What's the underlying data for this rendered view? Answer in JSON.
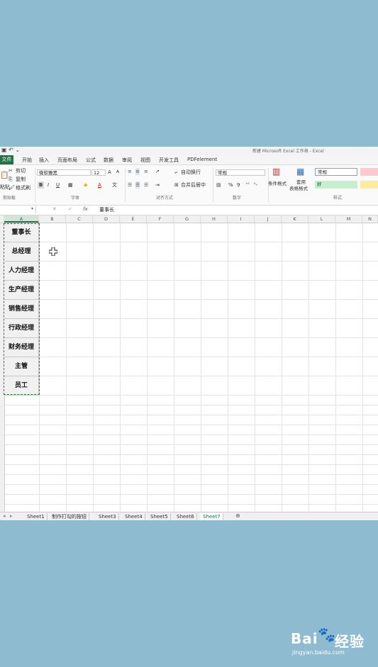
{
  "window": {
    "title": "新建 Microsoft Excel 工作表 - Excel",
    "qa_icons": "▣ ↶ ⌄"
  },
  "menu": {
    "file": "文件",
    "tabs": [
      "开始",
      "插入",
      "页面布局",
      "公式",
      "数据",
      "审阅",
      "视图",
      "开发工具",
      "PDFelement"
    ]
  },
  "ribbon": {
    "clipboard": {
      "cut": "剪切",
      "copy": "复制",
      "format_painter": "格式刷",
      "paste": "粘贴",
      "group": "剪贴板"
    },
    "font": {
      "name": "微软雅黑",
      "size": "12",
      "bold": "B",
      "italic": "I",
      "underline": "U",
      "grow": "A",
      "shrink": "A",
      "wen": "文",
      "group": "字体"
    },
    "alignment": {
      "wrap": "自动换行",
      "merge": "合并后居中",
      "group": "对齐方式"
    },
    "number": {
      "format": "常规",
      "percent": "%",
      "comma": "9",
      "group": "数字"
    },
    "styles": {
      "conditional": "条件格式",
      "table_format_1": "套用",
      "table_format_2": "表格格式",
      "normal": "常规",
      "good": "好",
      "group": "样式"
    }
  },
  "formula_bar": {
    "fx": "fx",
    "content": "董事长"
  },
  "columns": [
    "A",
    "B",
    "C",
    "D",
    "E",
    "F",
    "G",
    "H",
    "I",
    "J",
    "K",
    "L",
    "M",
    "N"
  ],
  "cells_a": [
    "董事长",
    "总经理",
    "人力经理",
    "生产经理",
    "销售经理",
    "行政经理",
    "财务经理",
    "主管",
    "员工"
  ],
  "sheets": [
    "Sheet1",
    "制作打勾的按钮",
    "Sheet3",
    "Sheet4",
    "Sheet5",
    "Sheet6",
    "Sheet7"
  ],
  "active_sheet": "Sheet7",
  "add_sheet": "⊕",
  "watermark": {
    "brand": "Bai",
    "brand2": "经验",
    "url": "jingyan.baidu.com"
  },
  "colors": {
    "excel_green": "#217346",
    "background": "#8fbbd0"
  }
}
